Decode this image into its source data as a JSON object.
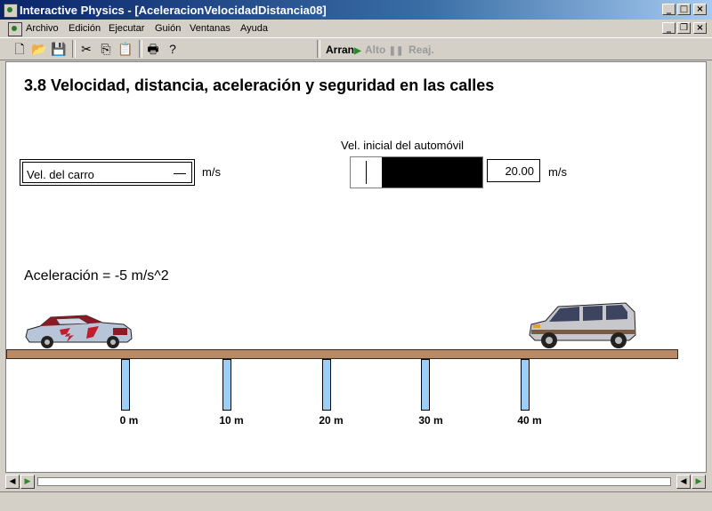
{
  "window": {
    "title": "Interactive Physics - [AceleracionVelocidadDistancia08]"
  },
  "menu": {
    "items": [
      "Archivo",
      "Edición",
      "Ejecutar",
      "Guión",
      "Ventanas",
      "Ayuda"
    ]
  },
  "toolbar": {
    "run_label": "Arran",
    "stop_label": "Alto",
    "reset_label": "Reaj."
  },
  "workspace": {
    "heading": "3.8 Velocidad, distancia, aceleración y seguridad en las calles",
    "velocity_meter": {
      "label": "Vel. del carro",
      "unit": "m/s"
    },
    "initial_velocity": {
      "title": "Vel. inicial del automóvil",
      "value": "20.00",
      "unit": "m/s"
    },
    "acceleration_text": "Aceleración = -5 m/s^2",
    "distance_marks": [
      "0 m",
      "10 m",
      "20 m",
      "30 m",
      "40 m"
    ]
  },
  "colors": {
    "title_bar": "#0a246a",
    "road": "#b88a66",
    "posts": "#9ccff7",
    "run_arrow": "#2a8a2a"
  }
}
